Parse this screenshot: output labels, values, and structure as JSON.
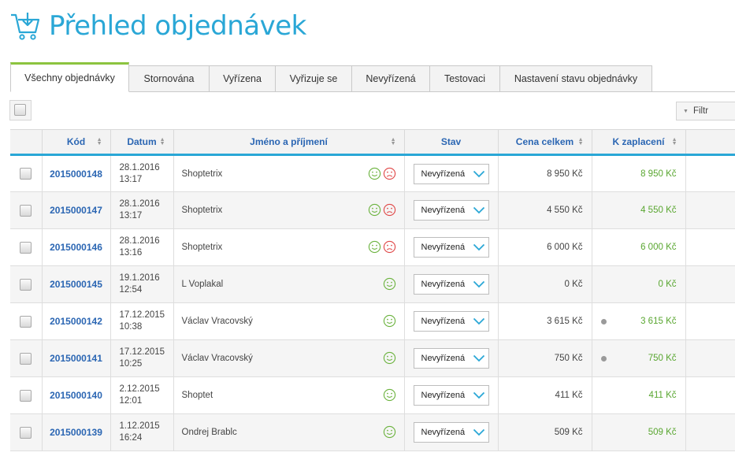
{
  "page": {
    "title": "Přehled objednávek"
  },
  "tabs": [
    {
      "label": "Všechny objednávky",
      "active": true
    },
    {
      "label": "Stornována",
      "active": false
    },
    {
      "label": "Vyřízena",
      "active": false
    },
    {
      "label": "Vyřizuje se",
      "active": false
    },
    {
      "label": "Nevyřízená",
      "active": false
    },
    {
      "label": "Testovaci",
      "active": false
    },
    {
      "label": "Nastavení stavu objednávky",
      "active": false
    }
  ],
  "toolbar": {
    "filter_label": "Filtr"
  },
  "columns": {
    "code": "Kód",
    "date": "Datum",
    "name": "Jméno a příjmení",
    "status": "Stav",
    "total": "Cena celkem",
    "to_pay": "K zaplacení"
  },
  "colors": {
    "accent": "#2aa7d6",
    "active_tab": "#8cc43f",
    "link": "#2b66b3",
    "paid": "#59a630",
    "sad": "#e04848"
  },
  "orders": [
    {
      "code": "2015000148",
      "date": "28.1.2016",
      "time": "13:17",
      "name": "Shoptetrix",
      "smileys": [
        "happy-icon",
        "sad-icon"
      ],
      "status": "Nevyřízená",
      "total": "8 950 Kč",
      "to_pay": "8 950 Kč",
      "dot": false
    },
    {
      "code": "2015000147",
      "date": "28.1.2016",
      "time": "13:17",
      "name": "Shoptetrix",
      "smileys": [
        "happy-icon",
        "sad-icon"
      ],
      "status": "Nevyřízená",
      "total": "4 550 Kč",
      "to_pay": "4 550 Kč",
      "dot": false
    },
    {
      "code": "2015000146",
      "date": "28.1.2016",
      "time": "13:16",
      "name": "Shoptetrix",
      "smileys": [
        "happy-icon",
        "sad-icon"
      ],
      "status": "Nevyřízená",
      "total": "6 000 Kč",
      "to_pay": "6 000 Kč",
      "dot": false
    },
    {
      "code": "2015000145",
      "date": "19.1.2016",
      "time": "12:54",
      "name": "L Voplakal",
      "smileys": [
        "happy-icon"
      ],
      "status": "Nevyřízená",
      "total": "0 Kč",
      "to_pay": "0 Kč",
      "dot": false
    },
    {
      "code": "2015000142",
      "date": "17.12.2015",
      "time": "10:38",
      "name": "Václav Vracovský",
      "smileys": [
        "happy-icon"
      ],
      "status": "Nevyřízená",
      "total": "3 615 Kč",
      "to_pay": "3 615 Kč",
      "dot": true
    },
    {
      "code": "2015000141",
      "date": "17.12.2015",
      "time": "10:25",
      "name": "Václav Vracovský",
      "smileys": [
        "happy-icon"
      ],
      "status": "Nevyřízená",
      "total": "750 Kč",
      "to_pay": "750 Kč",
      "dot": true
    },
    {
      "code": "2015000140",
      "date": "2.12.2015",
      "time": "12:01",
      "name": "Shoptet",
      "smileys": [
        "happy-icon"
      ],
      "status": "Nevyřízená",
      "total": "411 Kč",
      "to_pay": "411 Kč",
      "dot": false
    },
    {
      "code": "2015000139",
      "date": "1.12.2015",
      "time": "16:24",
      "name": "Ondrej Brablc",
      "smileys": [
        "happy-icon"
      ],
      "status": "Nevyřízená",
      "total": "509 Kč",
      "to_pay": "509 Kč",
      "dot": false
    }
  ]
}
